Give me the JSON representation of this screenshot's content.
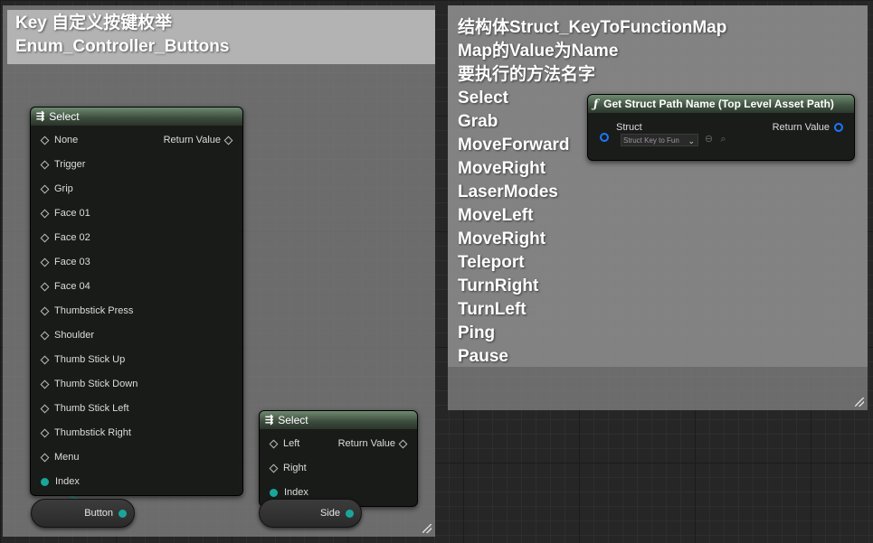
{
  "comment_left": {
    "title_line1": "Key 自定义按键枚举",
    "title_line2": "Enum_Controller_Buttons"
  },
  "comment_right": {
    "lines": [
      "结构体Struct_KeyToFunctionMap",
      "Map的Value为Name",
      "要执行的方法名字",
      "Select",
      "Grab",
      "MoveForward",
      "MoveRight",
      "LaserModes",
      "MoveLeft",
      "MoveRight",
      "Teleport",
      "TurnRight",
      "TurnLeft",
      "Ping",
      "Pause"
    ]
  },
  "select_node_1": {
    "title": "Select",
    "return_label": "Return Value",
    "options": [
      "None",
      "Trigger",
      "Grip",
      "Face 01",
      "Face 02",
      "Face 03",
      "Face 04",
      "Thumbstick Press",
      "Shoulder",
      "Thumb Stick Up",
      "Thumb Stick Down",
      "Thumb Stick Left",
      "Thumbstick Right",
      "Menu"
    ],
    "index_label": "Index"
  },
  "select_node_2": {
    "title": "Select",
    "return_label": "Return Value",
    "options": [
      "Left",
      "Right"
    ],
    "index_label": "Index"
  },
  "var_button": {
    "label": "Button"
  },
  "var_side": {
    "label": "Side"
  },
  "func_node": {
    "title": "Get Struct Path Name (Top Level Asset Path)",
    "input_label": "Struct",
    "return_label": "Return Value",
    "dropdown_value": "Struct Key to Fun"
  },
  "colors": {
    "teal_pin": "#1aa59a",
    "blue_pin": "#1a78ff",
    "node_header": "#3a4a3b"
  }
}
